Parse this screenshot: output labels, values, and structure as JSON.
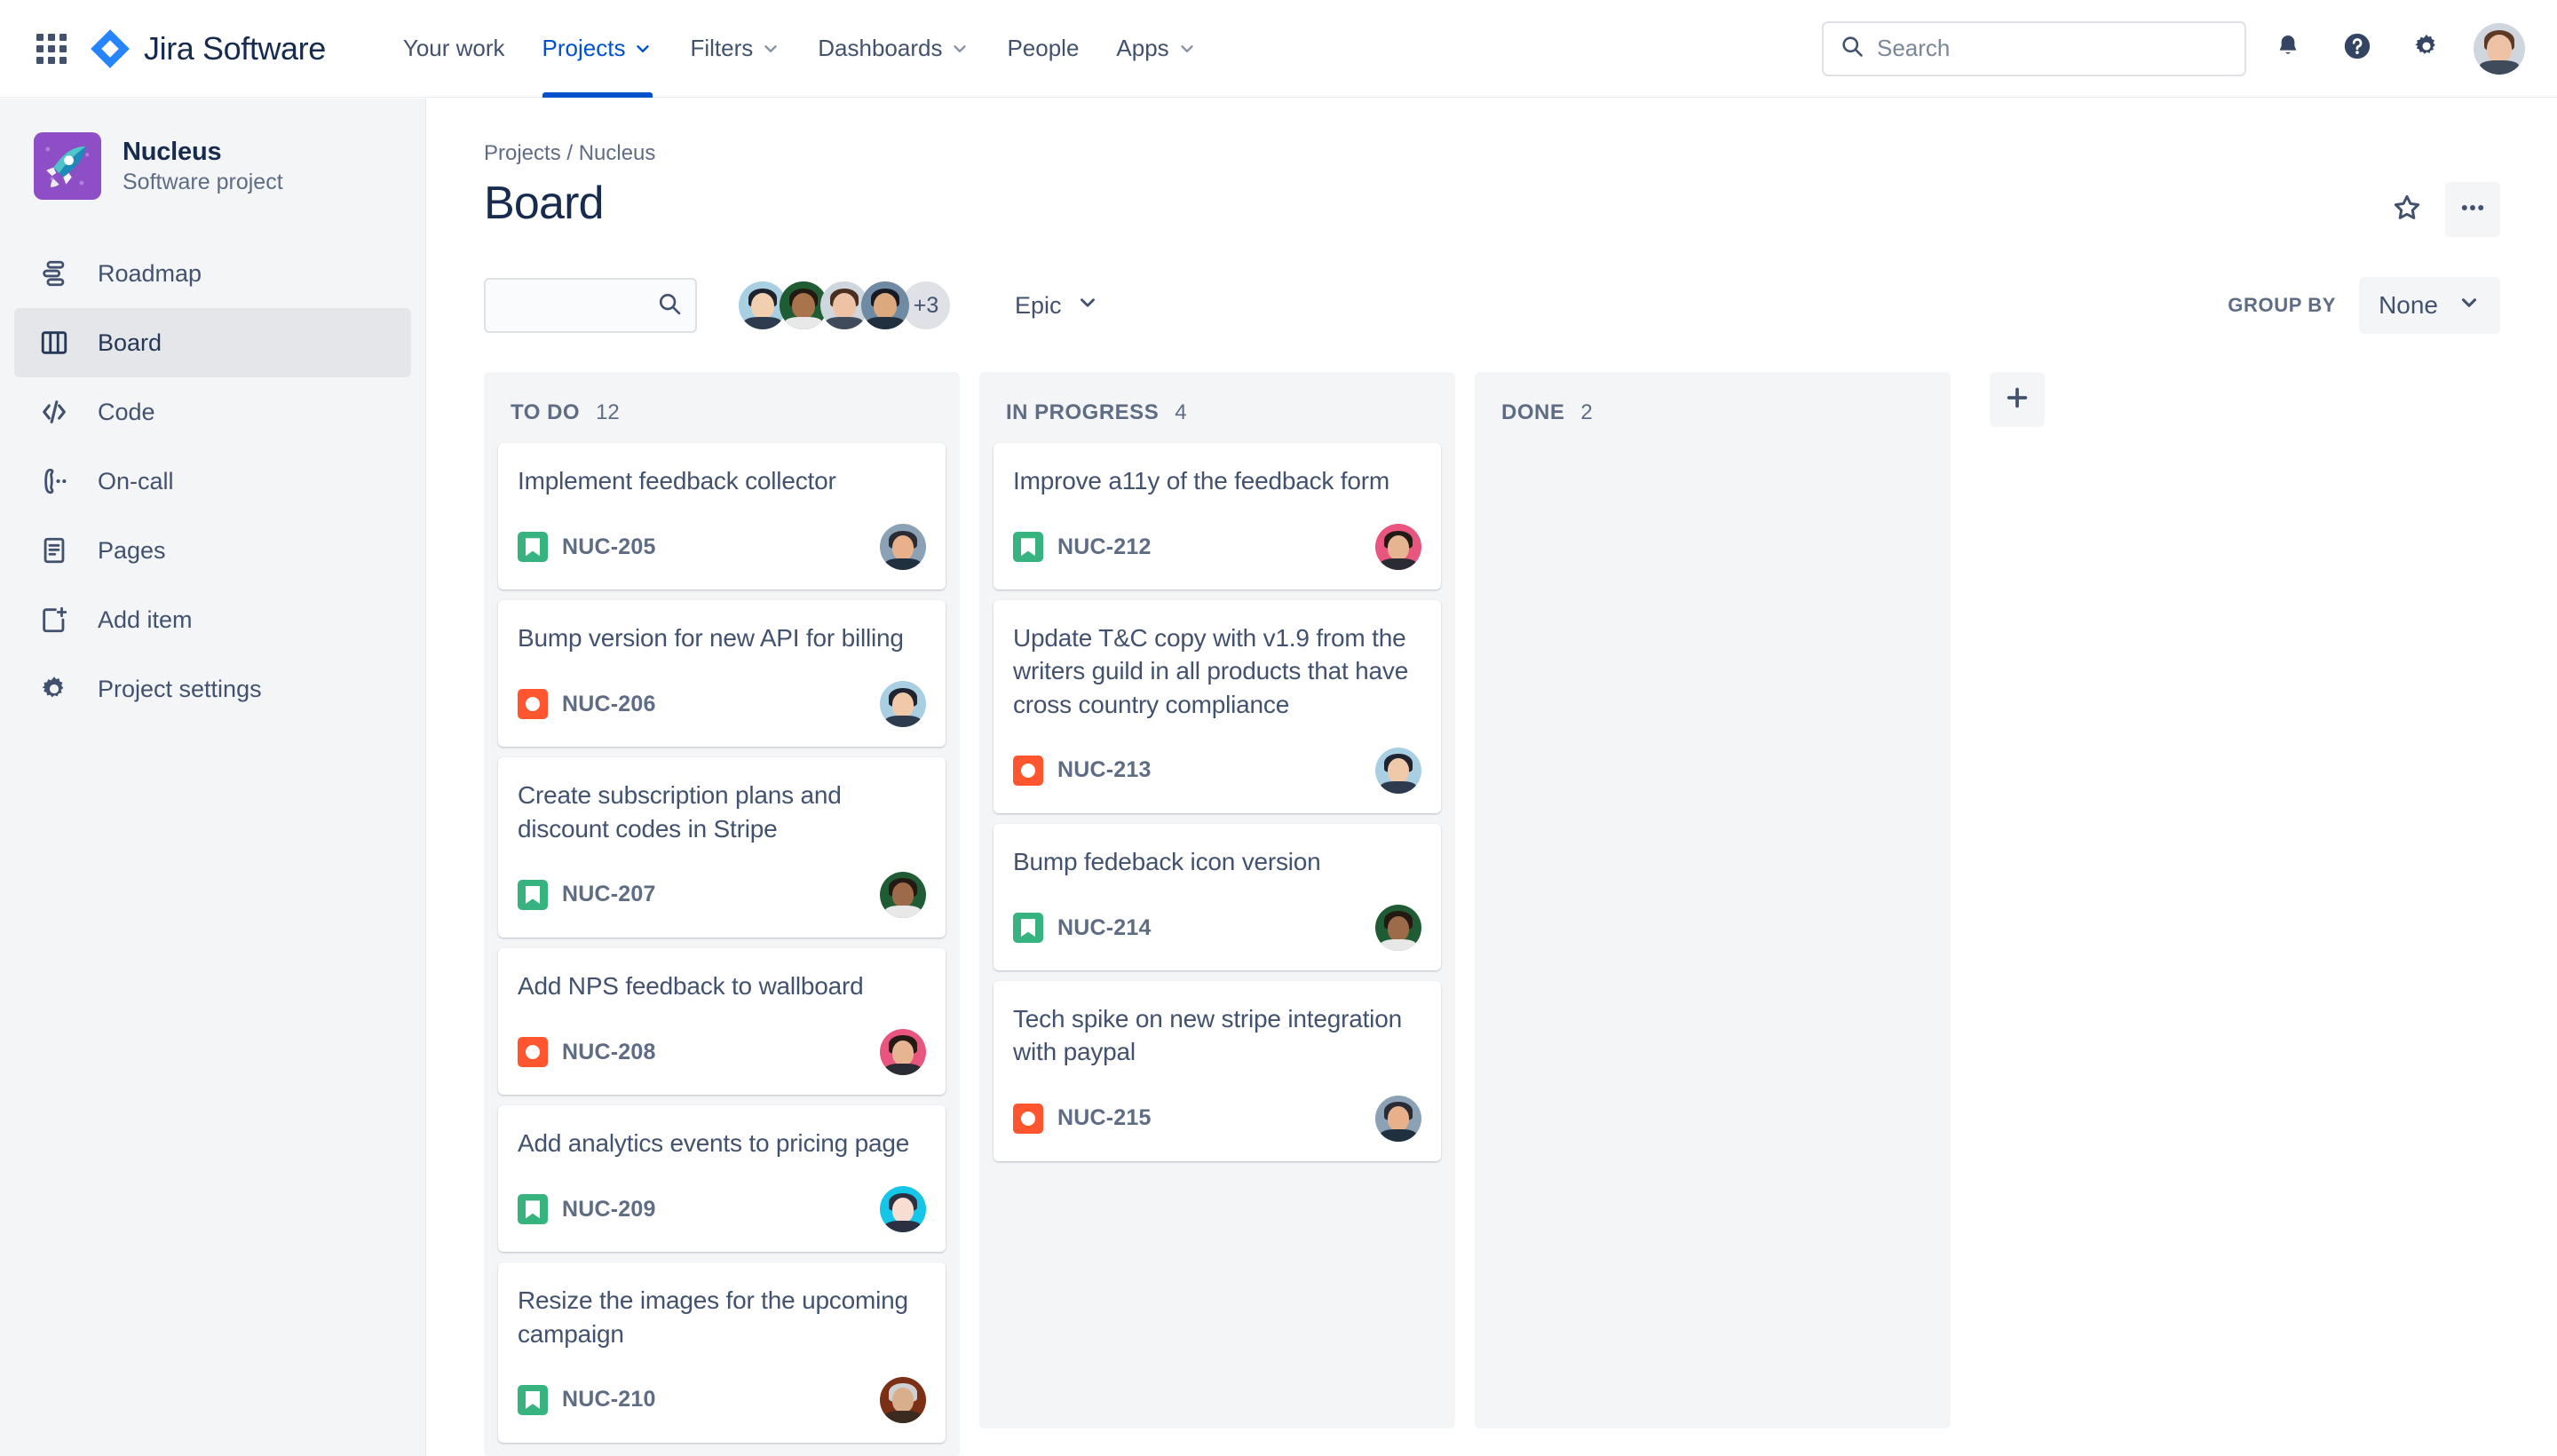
{
  "topnav": {
    "app_switcher_icon": "grid-icon",
    "brand": "Jira Software",
    "items": [
      {
        "label": "Your work",
        "has_chevron": false,
        "active": false
      },
      {
        "label": "Projects",
        "has_chevron": true,
        "active": true
      },
      {
        "label": "Filters",
        "has_chevron": true,
        "active": false
      },
      {
        "label": "Dashboards",
        "has_chevron": true,
        "active": false
      },
      {
        "label": "People",
        "has_chevron": false,
        "active": false
      },
      {
        "label": "Apps",
        "has_chevron": true,
        "active": false
      }
    ],
    "search": {
      "placeholder": "Search",
      "value": "",
      "icon": "search-icon"
    },
    "notifications_icon": "bell-icon",
    "help_icon": "help-circle-icon",
    "settings_icon": "gear-icon",
    "profile_avatar": "user-avatar"
  },
  "sidebar": {
    "project": {
      "name": "Nucleus",
      "type": "Software project",
      "avatar_icon": "rocket-icon"
    },
    "items": [
      {
        "label": "Roadmap",
        "icon": "roadmap-icon",
        "selected": false
      },
      {
        "label": "Board",
        "icon": "board-icon",
        "selected": true
      },
      {
        "label": "Code",
        "icon": "code-icon",
        "selected": false
      },
      {
        "label": "On-call",
        "icon": "phone-icon",
        "selected": false
      },
      {
        "label": "Pages",
        "icon": "page-icon",
        "selected": false
      },
      {
        "label": "Add item",
        "icon": "add-item-icon",
        "selected": false
      },
      {
        "label": "Project settings",
        "icon": "gear-icon",
        "selected": false
      }
    ]
  },
  "main": {
    "breadcrumb": "Projects / Nucleus",
    "page_title": "Board",
    "star_icon": "star-icon",
    "more_icon": "more-horizontal-icon",
    "board_search": {
      "placeholder": "",
      "value": "",
      "icon": "search-icon"
    },
    "avatars": {
      "visible_count": 4,
      "overflow_label": "+3"
    },
    "epic_filter": {
      "label": "Epic",
      "icon": "chevron-down-icon"
    },
    "group_by": {
      "label": "GROUP BY",
      "value": "None",
      "icon": "chevron-down-icon"
    },
    "add_column_icon": "plus-icon"
  },
  "colors": {
    "brand_blue": "#0052cc",
    "story_green": "#36b37e",
    "bug_red": "#ff5630",
    "text_dark": "#172b4d",
    "text_subtle": "#5e6c84",
    "column_bg": "#f4f5f7",
    "project_avatar_bg": "#8e4ec6"
  },
  "board": {
    "columns": [
      {
        "name": "TO DO",
        "count": "12",
        "cards": [
          {
            "title": "Implement feedback collector",
            "key": "NUC-205",
            "type": "story",
            "avatar_skin": "#e8b18c",
            "avatar_hair": "#2b2b33",
            "avatar_bg": "#8ba1b5"
          },
          {
            "title": "Bump version for new API for billing",
            "key": "NUC-206",
            "type": "bug",
            "avatar_skin": "#f0c9a8",
            "avatar_hair": "#1f2430",
            "avatar_bg": "#a9cfe3"
          },
          {
            "title": "Create subscription plans and discount codes in Stripe",
            "key": "NUC-207",
            "type": "story",
            "avatar_skin": "#9d6b4a",
            "avatar_hair": "#241a14",
            "avatar_bg": "#1f5c33"
          },
          {
            "title": "Add NPS feedback to wallboard",
            "key": "NUC-208",
            "type": "bug",
            "avatar_skin": "#e7b491",
            "avatar_hair": "#231a16",
            "avatar_bg": "#e8557f"
          },
          {
            "title": "Add analytics events to pricing page",
            "key": "NUC-209",
            "type": "story",
            "avatar_skin": "#f7ddd2",
            "avatar_hair": "#2b3142",
            "avatar_bg": "#16c6e8"
          },
          {
            "title": "Resize the images for the upcoming campaign",
            "key": "NUC-210",
            "type": "story",
            "avatar_skin": "#d8ae8d",
            "avatar_hair": "#cfd0d2",
            "avatar_bg": "#7b2f14"
          }
        ]
      },
      {
        "name": "IN PROGRESS",
        "count": "4",
        "cards": [
          {
            "title": "Improve a11y of the feedback form",
            "key": "NUC-212",
            "type": "story",
            "avatar_skin": "#e7b491",
            "avatar_hair": "#231a16",
            "avatar_bg": "#e8557f"
          },
          {
            "title": "Update T&C copy with v1.9 from the writers guild in all products that have cross country compliance",
            "key": "NUC-213",
            "type": "bug",
            "avatar_skin": "#f0c9a8",
            "avatar_hair": "#1f2430",
            "avatar_bg": "#a9cfe3"
          },
          {
            "title": "Bump fedeback icon version",
            "key": "NUC-214",
            "type": "story",
            "avatar_skin": "#9d6b4a",
            "avatar_hair": "#241a14",
            "avatar_bg": "#1f5c33"
          },
          {
            "title": "Tech spike on new stripe integration with paypal",
            "key": "NUC-215",
            "type": "bug",
            "avatar_skin": "#e8b18c",
            "avatar_hair": "#2b2b33",
            "avatar_bg": "#8ba1b5"
          }
        ]
      },
      {
        "name": "DONE",
        "count": "2",
        "cards": []
      }
    ],
    "filter_avatars": [
      {
        "skin": "#f2cfae",
        "hair": "#1d222e",
        "bg": "#a9cfe3"
      },
      {
        "skin": "#a9734c",
        "hair": "#221913",
        "bg": "#1f5c33"
      },
      {
        "skin": "#eec2a4",
        "hair": "#4a2f20",
        "bg": "#cfd6dd"
      },
      {
        "skin": "#dca97f",
        "hair": "#171a22",
        "bg": "#6f8aa3"
      }
    ]
  }
}
